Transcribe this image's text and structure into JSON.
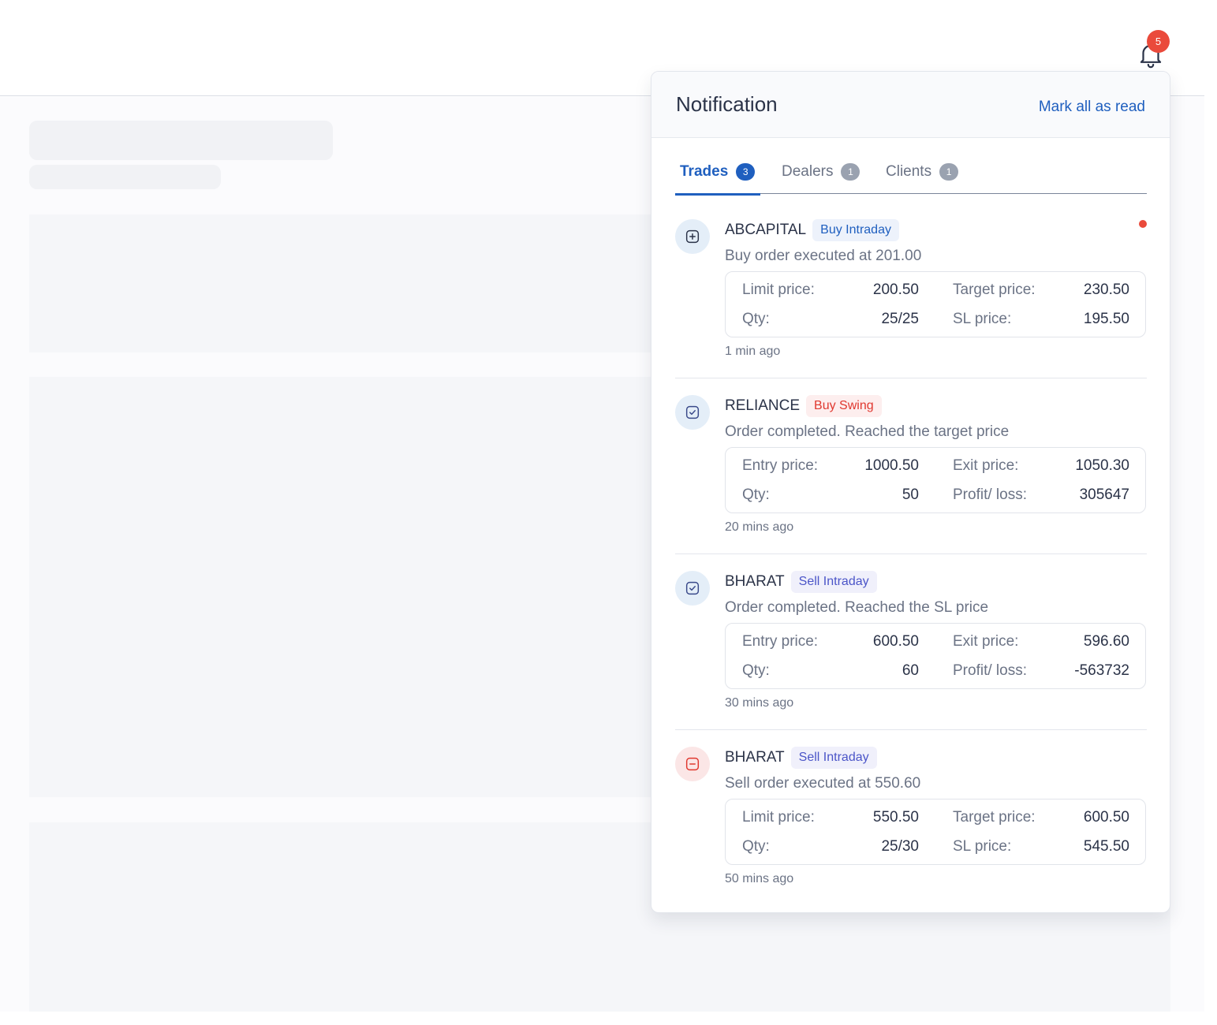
{
  "header": {
    "notification_count": "5"
  },
  "panel": {
    "title": "Notification",
    "mark_all_label": "Mark all as read",
    "tabs": [
      {
        "label": "Trades",
        "count": "3",
        "active": true
      },
      {
        "label": "Dealers",
        "count": "1",
        "active": false
      },
      {
        "label": "Clients",
        "count": "1",
        "active": false
      }
    ],
    "items": [
      {
        "icon": "plus-square-icon",
        "symbol": "ABCAPITAL",
        "tag": "Buy Intraday",
        "message": "Buy order executed at 201.00",
        "fields": [
          {
            "label": "Limit price:",
            "value": "200.50"
          },
          {
            "label": "Target price:",
            "value": "230.50"
          },
          {
            "label": "Qty:",
            "value": "25/25"
          },
          {
            "label": "SL price:",
            "value": "195.50"
          }
        ],
        "time": "1 min ago",
        "unread": true
      },
      {
        "icon": "check-square-icon",
        "symbol": "RELIANCE",
        "tag": "Buy Swing",
        "message": "Order completed. Reached the target price",
        "fields": [
          {
            "label": "Entry price:",
            "value": "1000.50"
          },
          {
            "label": "Exit price:",
            "value": "1050.30"
          },
          {
            "label": "Qty:",
            "value": "50"
          },
          {
            "label": "Profit/ loss:",
            "value": "305647"
          }
        ],
        "time": "20 mins ago",
        "unread": false
      },
      {
        "icon": "check-square-icon",
        "symbol": "BHARAT",
        "tag": "Sell Intraday",
        "message": "Order completed. Reached the SL price",
        "fields": [
          {
            "label": "Entry price:",
            "value": "600.50"
          },
          {
            "label": "Exit price:",
            "value": "596.60"
          },
          {
            "label": "Qty:",
            "value": "60"
          },
          {
            "label": "Profit/ loss:",
            "value": "-563732"
          }
        ],
        "time": "30 mins ago",
        "unread": false
      },
      {
        "icon": "minus-square-icon",
        "symbol": "BHARAT",
        "tag": "Sell Intraday",
        "message": "Sell order executed at 550.60",
        "fields": [
          {
            "label": "Limit price:",
            "value": "550.50"
          },
          {
            "label": "Target price:",
            "value": "600.50"
          },
          {
            "label": "Qty:",
            "value": "25/30"
          },
          {
            "label": "SL price:",
            "value": "545.50"
          }
        ],
        "time": "50 mins ago",
        "unread": false
      }
    ]
  },
  "colors": {
    "accent": "#1f5fbf",
    "badge_red": "#ea4a3b",
    "buy_swing_red": "#e0382f",
    "sell_purple": "#4b55c8"
  }
}
